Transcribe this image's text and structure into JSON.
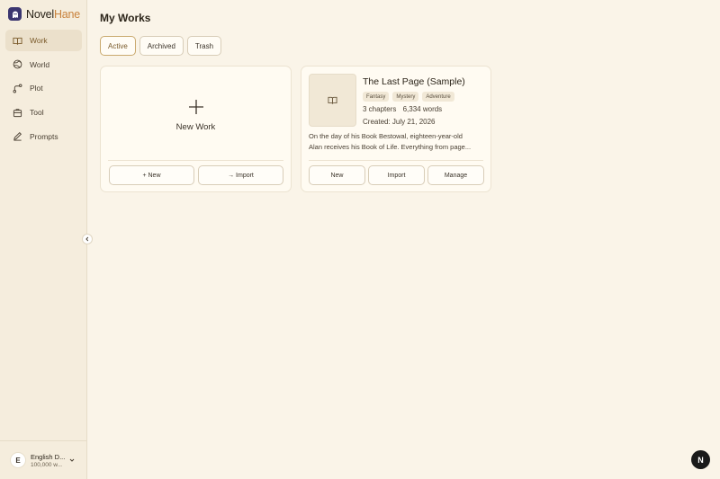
{
  "app": {
    "name_part1": "Novel",
    "name_part2": "Hane"
  },
  "sidebar": {
    "items": [
      {
        "label": "Work",
        "icon": "book-open-icon",
        "active": true
      },
      {
        "label": "World",
        "icon": "globe-icon",
        "active": false
      },
      {
        "label": "Plot",
        "icon": "route-icon",
        "active": false
      },
      {
        "label": "Tool",
        "icon": "toolbox-icon",
        "active": false
      },
      {
        "label": "Prompts",
        "icon": "pen-icon",
        "active": false
      }
    ],
    "user": {
      "initial": "E",
      "name": "English D...",
      "sub": "100,000 w..."
    }
  },
  "main": {
    "title": "My Works",
    "tabs": [
      {
        "label": "Active",
        "active": true
      },
      {
        "label": "Archived",
        "active": false
      },
      {
        "label": "Trash",
        "active": false
      }
    ],
    "new_card": {
      "label": "New Work",
      "new_button": "+ New",
      "import_button": "→ Import"
    },
    "work_card": {
      "title": "The Last Page (Sample)",
      "tags": [
        "Fantasy",
        "Mystery",
        "Adventure"
      ],
      "chapters": "3 chapters",
      "words": "6,334 words",
      "created": "Created: July 21, 2026",
      "desc_line1": "On the day of his Book Bestowal, eighteen-year-old",
      "desc_line2": "Alan receives his Book of Life. Everything from page...",
      "buttons": {
        "new": "New",
        "import": "Import",
        "manage": "Manage"
      }
    }
  },
  "badge": {
    "label": "N"
  },
  "colors": {
    "accent": "#c9823c",
    "logo_bg": "#3b3670",
    "active_bg": "#ebe0cb"
  }
}
